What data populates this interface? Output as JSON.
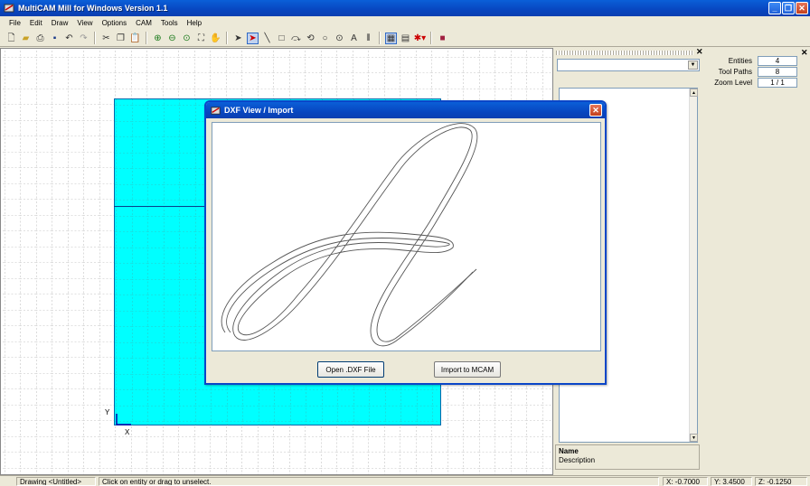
{
  "window": {
    "title": "MultiCAM Mill for Windows Version 1.1"
  },
  "menu": [
    "File",
    "Edit",
    "Draw",
    "View",
    "Options",
    "CAM",
    "Tools",
    "Help"
  ],
  "toolbar": {
    "icons": [
      "new-icon",
      "open-icon",
      "print-icon",
      "save-icon",
      "undo-icon",
      "redo-icon",
      "cut-icon",
      "copy-icon",
      "paste-icon",
      "zoom-in-icon",
      "zoom-out-icon",
      "zoom-window-icon",
      "zoom-extents-icon",
      "pan-icon",
      "select-icon",
      "select-entity-icon",
      "line-icon",
      "rectangle-icon",
      "arc-icon",
      "arc-3pt-icon",
      "circle-icon",
      "circle-center-icon",
      "text-icon",
      "drill-icon",
      "grid-icon",
      "snap-icon",
      "toolpath-icon",
      "book-icon"
    ]
  },
  "canvas": {
    "y_axis_label": "Y",
    "x_axis_label": "X",
    "stock_color": "#00ffff"
  },
  "dialog": {
    "title": "DXF View / Import",
    "open_button": "Open .DXF File",
    "import_button": "Import to MCAM"
  },
  "stats": {
    "entities_label": "Entities",
    "entities_value": "4",
    "toolpaths_label": "Tool Paths",
    "toolpaths_value": "8",
    "zoom_label": "Zoom Level",
    "zoom_value": "1 / 1"
  },
  "info": {
    "name_label": "Name",
    "description_label": "Description"
  },
  "status": {
    "drawing": "Drawing <Untitled>",
    "hint": "Click on entity or drag to unselect.",
    "x": "X: -0.7000",
    "y": "Y: 3.4500",
    "z": "Z: -0.1250"
  },
  "colors": {
    "titlebar": "#0a5fd8",
    "stock": "#00ffff"
  }
}
